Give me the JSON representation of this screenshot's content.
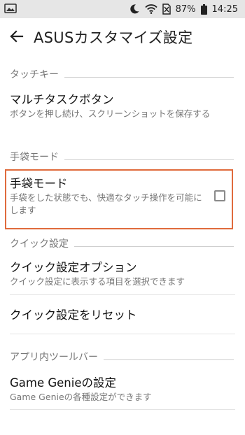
{
  "status_bar": {
    "battery": "87%",
    "time": "14:25",
    "icons": [
      "image-icon",
      "moon-icon",
      "wifi-icon",
      "no-sim-icon",
      "battery-icon"
    ]
  },
  "app_bar": {
    "title": "ASUSカスタマイズ設定",
    "back_icon": "arrow-back-icon"
  },
  "sections": {
    "touch_key": {
      "header": "タッチキー",
      "items": [
        {
          "title": "マルチタスクボタン",
          "summary": "ボタンを押し続け、スクリーンショットを保存する"
        }
      ]
    },
    "glove_mode": {
      "header": "手袋モード",
      "items": [
        {
          "title": "手袋モード",
          "summary": "手袋をした状態でも、快適なタッチ操作を可能にします",
          "checked": false
        }
      ]
    },
    "quick_settings": {
      "header": "クイック設定",
      "items": [
        {
          "title": "クイック設定オプション",
          "summary": "クイック設定に表示する項目を選択できます"
        },
        {
          "title": "クイック設定をリセット"
        }
      ]
    },
    "in_app_toolbar": {
      "header": "アプリ内ツールバー",
      "items": [
        {
          "title": "Game Genieの設定",
          "summary": "Game Genieの各種設定ができます"
        }
      ]
    }
  },
  "colors": {
    "status_bar_bg": "#e6e6e6",
    "highlight_border": "#e06b3c",
    "secondary_text": "#777777"
  }
}
